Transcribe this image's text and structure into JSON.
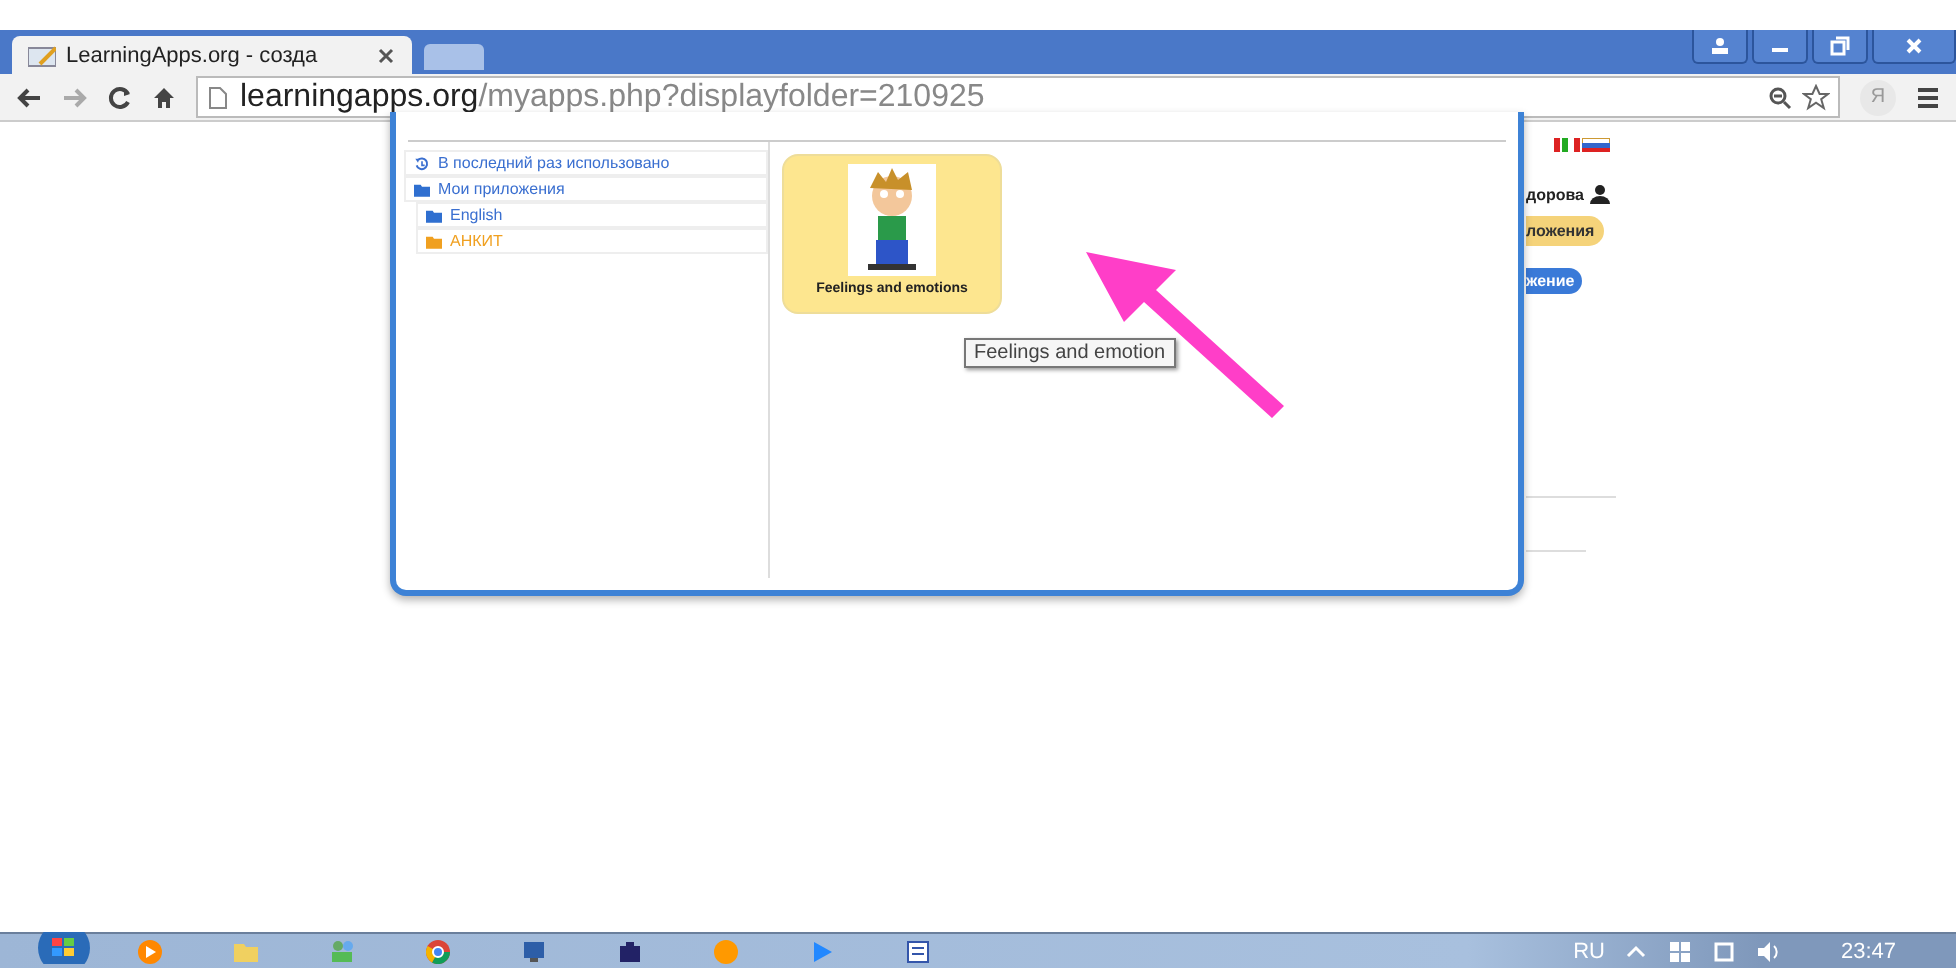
{
  "browser": {
    "tab_title": "LearningApps.org - созда",
    "url_domain": "learningapps.org",
    "url_path": "/myapps.php?displayfolder=210925",
    "profile_letter": "Я"
  },
  "dialog": {
    "tree": [
      {
        "kind": "recent",
        "label": "В последний раз использовано",
        "selected": false
      },
      {
        "kind": "folder",
        "label": "Мои приложения",
        "selected": false,
        "children": [
          {
            "kind": "folder",
            "label": "English",
            "selected": false
          },
          {
            "kind": "folder",
            "label": "АНКИТ",
            "selected": true
          }
        ]
      }
    ],
    "tiles": [
      {
        "title": "Feelings and emotions"
      }
    ],
    "tooltip": "Feelings and emotion"
  },
  "background": {
    "user_name": "дорова",
    "apps_button": "ложения",
    "create_button": "жение"
  },
  "taskbar": {
    "language": "RU",
    "time": "23:47"
  }
}
